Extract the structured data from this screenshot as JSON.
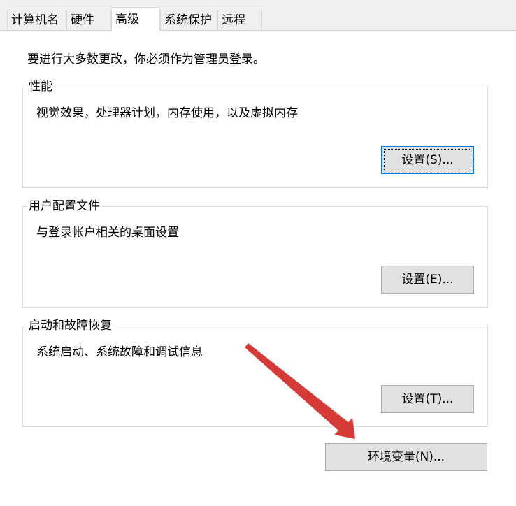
{
  "tabs": [
    {
      "label": "计算机名",
      "active": false
    },
    {
      "label": "硬件",
      "active": false
    },
    {
      "label": "高级",
      "active": true
    },
    {
      "label": "系统保护",
      "active": false
    },
    {
      "label": "远程",
      "active": false
    }
  ],
  "intro": "要进行大多数更改，你必须作为管理员登录。",
  "performance": {
    "title": "性能",
    "description": "视觉效果，处理器计划，内存使用，以及虚拟内存",
    "button": "设置(S)..."
  },
  "user_profiles": {
    "title": "用户配置文件",
    "description": "与登录帐户相关的桌面设置",
    "button": "设置(E)..."
  },
  "startup_recovery": {
    "title": "启动和故障恢复",
    "description": "系统启动、系统故障和调试信息",
    "button": "设置(T)..."
  },
  "environment_variables": {
    "button": "环境变量(N)..."
  },
  "colors": {
    "tab_active": "#ffffff",
    "tab_inactive": "#f0f0f0",
    "button_face": "#e1e1e1",
    "focus_border": "#0078d7",
    "annotation_arrow": "#d63a37"
  },
  "annotation": {
    "arrow_icon": "red-arrow-icon"
  }
}
